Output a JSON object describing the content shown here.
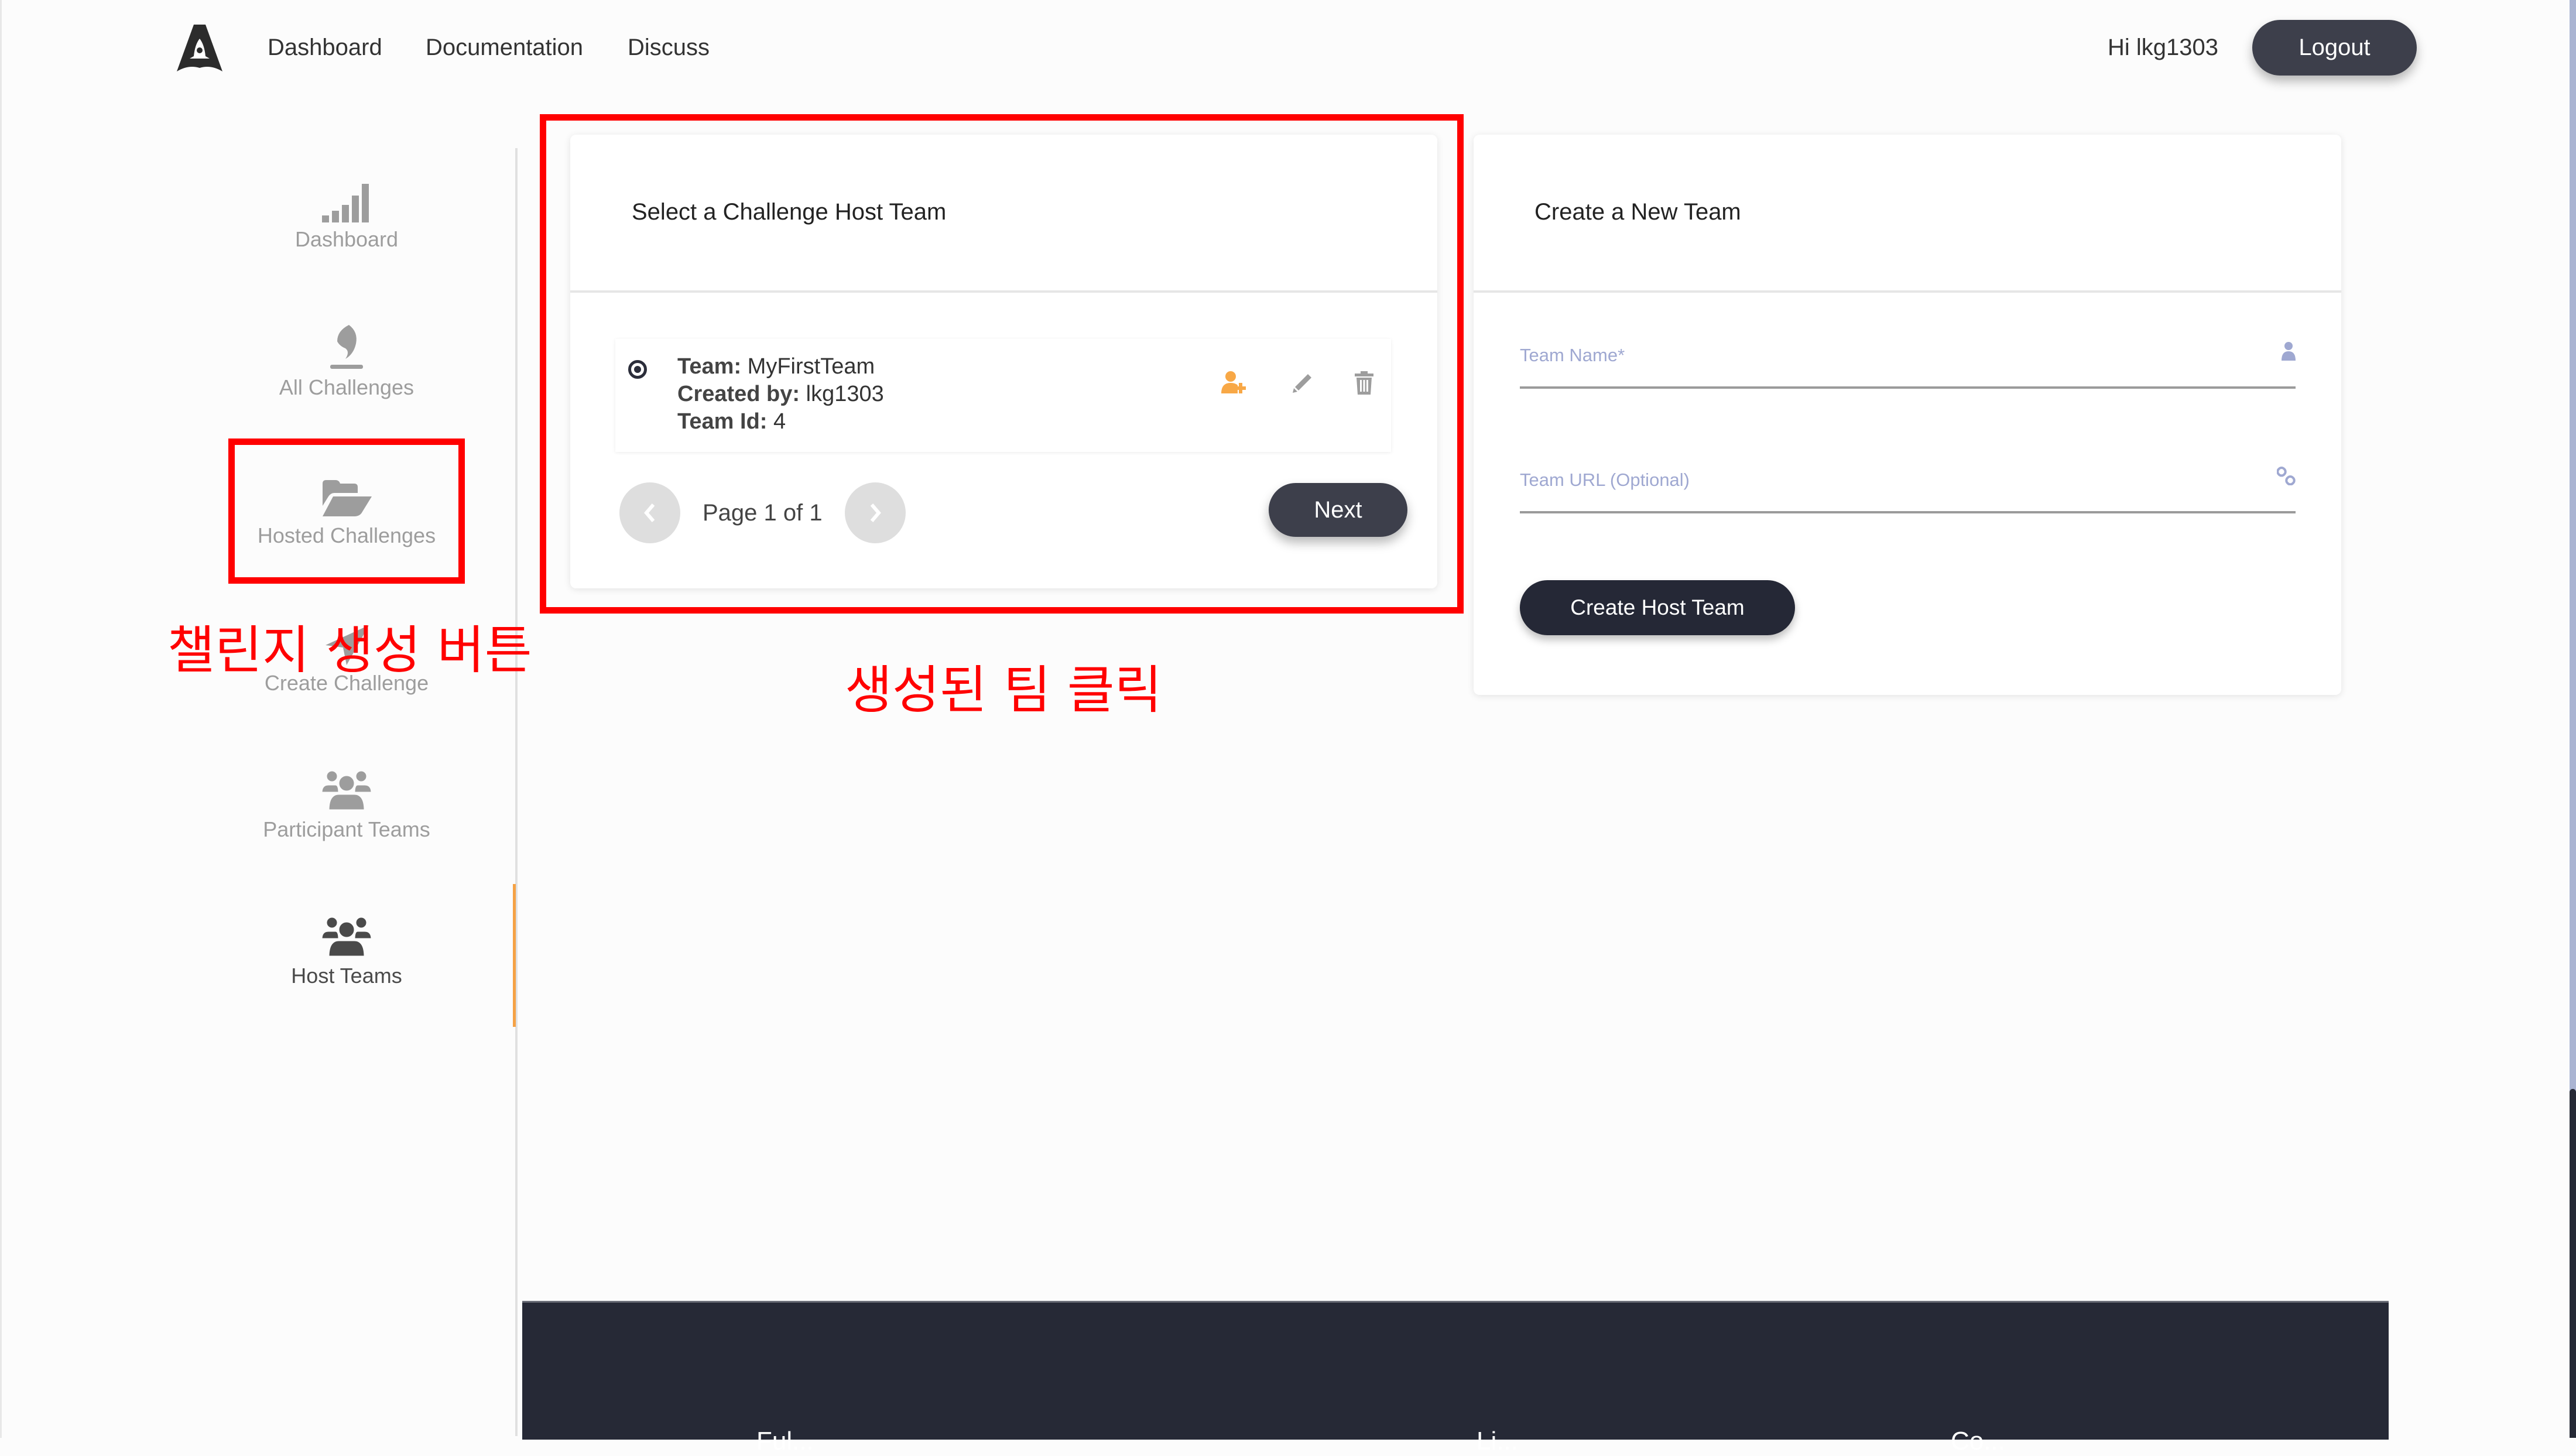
{
  "header": {
    "logo": "evalai-rocket-logo",
    "nav": [
      "Dashboard",
      "Documentation",
      "Discuss"
    ],
    "greeting_prefix": "Hi ",
    "username": "lkg1303",
    "logout_label": "Logout"
  },
  "sidebar": {
    "active": "Host Teams",
    "accent_color": "#f5a245",
    "items": [
      {
        "label": "Dashboard",
        "icon": "signal-bars-icon"
      },
      {
        "label": "All Challenges",
        "icon": "fire-icon"
      },
      {
        "label": "Hosted Challenges",
        "icon": "folder-open-icon"
      },
      {
        "label": "Create Challenge",
        "icon": "location-arrow-icon"
      },
      {
        "label": "Participant Teams",
        "icon": "users-icon"
      },
      {
        "label": "Host Teams",
        "icon": "users-icon"
      }
    ]
  },
  "select_team_card": {
    "title": "Select a Challenge Host Team",
    "teams": [
      {
        "selected": true,
        "team_label": "Team:",
        "team_name": "MyFirstTeam",
        "created_by_label": "Created by:",
        "created_by": "lkg1303",
        "team_id_label": "Team Id:",
        "team_id": "4",
        "actions": [
          "add-member-icon",
          "edit-icon",
          "delete-icon"
        ]
      }
    ],
    "pagination": {
      "text": "Page 1 of 1",
      "current": 1,
      "total": 1
    },
    "next_label": "Next"
  },
  "create_team_card": {
    "title": "Create a New Team",
    "team_name": {
      "value": "",
      "placeholder": "Team Name*"
    },
    "team_url": {
      "value": "",
      "placeholder": "Team URL (Optional)"
    },
    "submit_label": "Create Host Team"
  },
  "footer": {
    "headings_partial": [
      "Ful...",
      "Li...",
      "Co..."
    ]
  },
  "annotations": {
    "color": "#ff0000",
    "sidebar_note": "챌린지 생성 버튼",
    "card_note": "생성된 팀 클릭"
  },
  "scrollbar": {
    "position_fraction": 1.0
  }
}
